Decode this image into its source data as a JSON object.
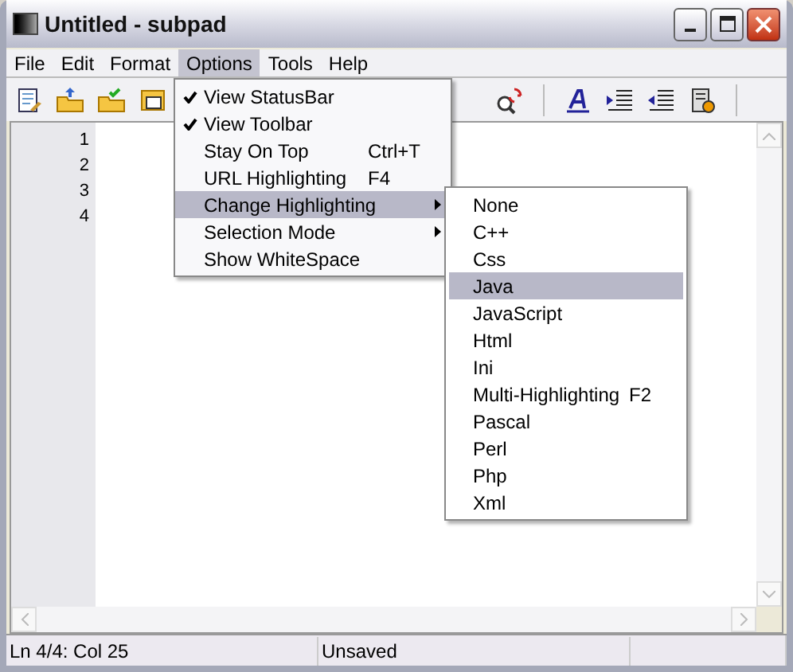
{
  "window": {
    "title": "Untitled - subpad"
  },
  "menu_bar": [
    {
      "label": "File",
      "selected": false
    },
    {
      "label": "Edit",
      "selected": false
    },
    {
      "label": "Format",
      "selected": false
    },
    {
      "label": "Options",
      "selected": true
    },
    {
      "label": "Tools",
      "selected": false
    },
    {
      "label": "Help",
      "selected": false
    }
  ],
  "options_menu": [
    {
      "label": "View StatusBar",
      "checked": true,
      "selected": false,
      "kind": "command"
    },
    {
      "label": "View Toolbar",
      "checked": true,
      "selected": false,
      "kind": "command"
    },
    {
      "label": "Stay On Top",
      "shortcut": "Ctrl+T",
      "checked": false,
      "selected": false,
      "kind": "command"
    },
    {
      "label": "URL Highlighting",
      "shortcut": "F4",
      "checked": false,
      "selected": false,
      "kind": "command"
    },
    {
      "label": "Change Highlighting",
      "checked": false,
      "selected": true,
      "kind": "submenu"
    },
    {
      "label": "Selection Mode",
      "checked": false,
      "selected": false,
      "kind": "submenu"
    },
    {
      "label": "Show WhiteSpace",
      "checked": false,
      "selected": false,
      "kind": "command"
    }
  ],
  "highlighting_submenu": [
    {
      "label": "None",
      "selected": false
    },
    {
      "label": "C++",
      "selected": false
    },
    {
      "label": "Css",
      "selected": false
    },
    {
      "label": "Java",
      "selected": true
    },
    {
      "label": "JavaScript",
      "selected": false
    },
    {
      "label": "Html",
      "selected": false
    },
    {
      "label": "Ini",
      "selected": false
    },
    {
      "label": "Multi-Highlighting",
      "shortcut": "F2",
      "selected": false
    },
    {
      "label": "Pascal",
      "selected": false
    },
    {
      "label": "Perl",
      "selected": false
    },
    {
      "label": "Php",
      "selected": false
    },
    {
      "label": "Xml",
      "selected": false
    }
  ],
  "line_numbers": [
    "1",
    "2",
    "3",
    "4"
  ],
  "status_bar": [
    "Ln 4/4: Col 25",
    "Unsaved"
  ]
}
